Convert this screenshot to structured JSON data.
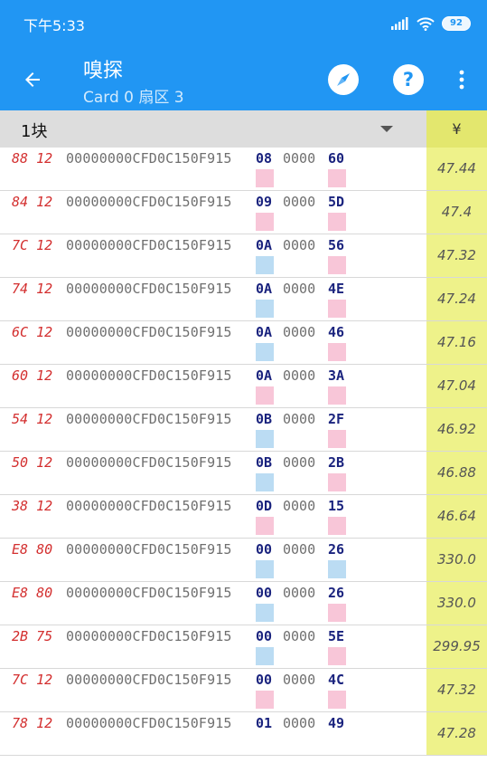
{
  "status_bar": {
    "time": "下午5:33",
    "battery": "92"
  },
  "app_bar": {
    "title": "嗅探",
    "subtitle": "Card 0 扇区 3"
  },
  "header": {
    "block_label": "1块",
    "currency": "¥"
  },
  "colors": {
    "pink": "#f8c6d8",
    "blue": "#bbdcf3",
    "accent": "#2196f3",
    "price_bg": "#eef28a"
  },
  "rows": [
    {
      "flags": "88 12",
      "id": "00000000CFD0C150F915",
      "b1": "08",
      "mid": "0000",
      "b2": "60",
      "c1": "#f8c6d8",
      "c2": "#f8c6d8",
      "price": "47.44"
    },
    {
      "flags": "84 12",
      "id": "00000000CFD0C150F915",
      "b1": "09",
      "mid": "0000",
      "b2": "5D",
      "c1": "#f8c6d8",
      "c2": "#f8c6d8",
      "price": "47.4"
    },
    {
      "flags": "7C 12",
      "id": "00000000CFD0C150F915",
      "b1": "0A",
      "mid": "0000",
      "b2": "56",
      "c1": "#bbdcf3",
      "c2": "#f8c6d8",
      "price": "47.32"
    },
    {
      "flags": "74 12",
      "id": "00000000CFD0C150F915",
      "b1": "0A",
      "mid": "0000",
      "b2": "4E",
      "c1": "#bbdcf3",
      "c2": "#f8c6d8",
      "price": "47.24"
    },
    {
      "flags": "6C 12",
      "id": "00000000CFD0C150F915",
      "b1": "0A",
      "mid": "0000",
      "b2": "46",
      "c1": "#bbdcf3",
      "c2": "#f8c6d8",
      "price": "47.16"
    },
    {
      "flags": "60 12",
      "id": "00000000CFD0C150F915",
      "b1": "0A",
      "mid": "0000",
      "b2": "3A",
      "c1": "#f8c6d8",
      "c2": "#f8c6d8",
      "price": "47.04"
    },
    {
      "flags": "54 12",
      "id": "00000000CFD0C150F915",
      "b1": "0B",
      "mid": "0000",
      "b2": "2F",
      "c1": "#bbdcf3",
      "c2": "#f8c6d8",
      "price": "46.92"
    },
    {
      "flags": "50 12",
      "id": "00000000CFD0C150F915",
      "b1": "0B",
      "mid": "0000",
      "b2": "2B",
      "c1": "#bbdcf3",
      "c2": "#f8c6d8",
      "price": "46.88"
    },
    {
      "flags": "38 12",
      "id": "00000000CFD0C150F915",
      "b1": "0D",
      "mid": "0000",
      "b2": "15",
      "c1": "#f8c6d8",
      "c2": "#f8c6d8",
      "price": "46.64"
    },
    {
      "flags": "E8 80",
      "id": "00000000CFD0C150F915",
      "b1": "00",
      "mid": "0000",
      "b2": "26",
      "c1": "#bbdcf3",
      "c2": "#bbdcf3",
      "price": "330.0"
    },
    {
      "flags": "E8 80",
      "id": "00000000CFD0C150F915",
      "b1": "00",
      "mid": "0000",
      "b2": "26",
      "c1": "#bbdcf3",
      "c2": "#f8c6d8",
      "price": "330.0"
    },
    {
      "flags": "2B 75",
      "id": "00000000CFD0C150F915",
      "b1": "00",
      "mid": "0000",
      "b2": "5E",
      "c1": "#bbdcf3",
      "c2": "#f8c6d8",
      "price": "299.95"
    },
    {
      "flags": "7C 12",
      "id": "00000000CFD0C150F915",
      "b1": "00",
      "mid": "0000",
      "b2": "4C",
      "c1": "#f8c6d8",
      "c2": "#f8c6d8",
      "price": "47.32"
    },
    {
      "flags": "78 12",
      "id": "00000000CFD0C150F915",
      "b1": "01",
      "mid": "0000",
      "b2": "49",
      "c1": "",
      "c2": "",
      "price": "47.28"
    }
  ]
}
